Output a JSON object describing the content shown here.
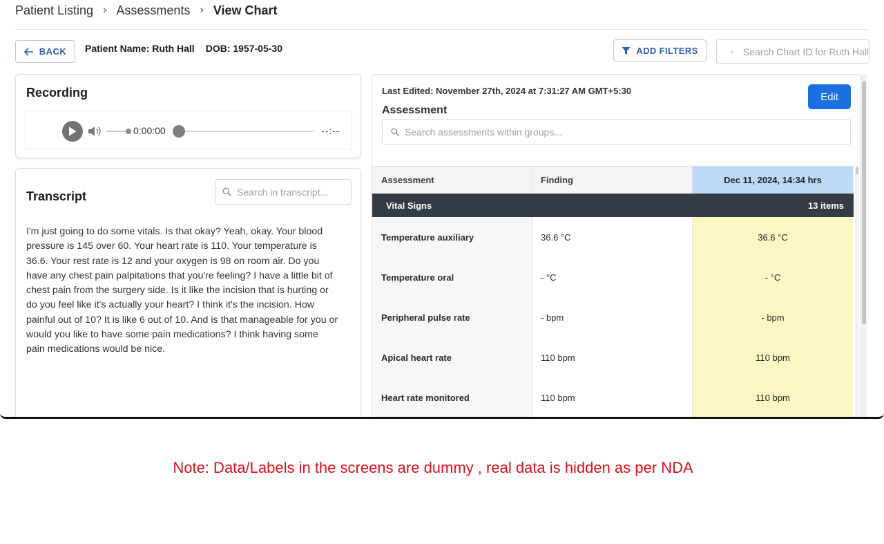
{
  "breadcrumb": {
    "items": [
      "Patient Listing",
      "Assessments",
      "View Chart"
    ],
    "separator": "›"
  },
  "toolbar": {
    "back_label": "BACK",
    "patient_name": "Patient Name: Ruth Hall",
    "dob": "DOB: 1957-05-30",
    "filters_label": "ADD FILTERS",
    "chart_search_placeholder": "Search Chart ID for Ruth Hall"
  },
  "recording": {
    "title": "Recording",
    "current_time": "0:00:00",
    "total_time": "--:--",
    "progress": 0
  },
  "transcript": {
    "title": "Transcript",
    "search_placeholder": "Search in transcript...",
    "text": "I'm just going to do some vitals. Is that okay? Yeah, okay. Your blood pressure is 145 over 60. Your heart rate is 110. Your temperature is 36.6. Your rest rate is 12 and your oxygen is 98 on room air. Do you have any chest pain palpitations that you're feeling? I have a little bit of chest pain from the surgery side. Is it like the incision that is hurting or do you feel like it's actually your heart? I think it's the incision. How painful out of 10? It is like 6 out of 10. And is that manageable for you or would you like to have some pain medications? I think having some pain medications would be nice."
  },
  "assessment": {
    "last_edited": "Last Edited: November 27th, 2024 at 7:31:27 AM GMT+5:30",
    "edit_label": "Edit",
    "title": "Assessment",
    "search_placeholder": "Search assessments within groups...",
    "columns": [
      "Assessment",
      "Finding",
      "Dec 11, 2024, 14:34 hrs"
    ],
    "group": {
      "name": "Vital Signs",
      "count": "13 items"
    },
    "rows": [
      {
        "assessment": "Temperature auxiliary",
        "finding": "36.6 °C",
        "value": "36.6 °C"
      },
      {
        "assessment": "Temperature oral",
        "finding": "- °C",
        "value": "- °C"
      },
      {
        "assessment": "Peripheral pulse rate",
        "finding": "- bpm",
        "value": "- bpm"
      },
      {
        "assessment": "Apical heart rate",
        "finding": "110 bpm",
        "value": "110 bpm"
      },
      {
        "assessment": "Heart rate monitored",
        "finding": "110 bpm",
        "value": "110 bpm"
      }
    ]
  },
  "colors": {
    "primary": "#1b6fe0",
    "link": "#2c5ea8",
    "group_header": "#343b45",
    "date_header": "#bcd9f7",
    "highlight": "#fbf6c2",
    "note": "#d8121b"
  },
  "note": "Note: Data/Labels in the screens are dummy , real data is hidden as per NDA"
}
